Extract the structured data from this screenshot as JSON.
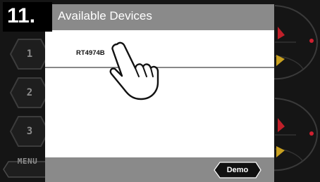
{
  "step": {
    "number": "11."
  },
  "sidebar": {
    "items": [
      {
        "label": "1"
      },
      {
        "label": "2"
      },
      {
        "label": "3"
      }
    ],
    "menu_label": "MENU"
  },
  "dialog": {
    "title": "Available Devices",
    "devices": [
      {
        "name": "RT4974B"
      }
    ],
    "demo_label": "Demo"
  },
  "icons": {
    "pointer": "hand-pointer-icon"
  }
}
